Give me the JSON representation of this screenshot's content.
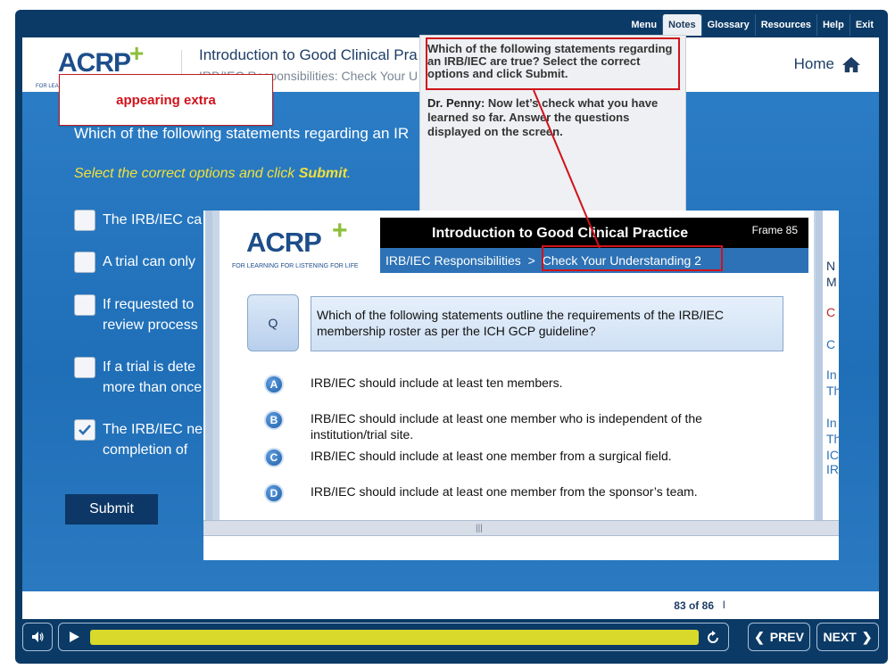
{
  "top_menu": [
    "Menu",
    "Notes",
    "Glossary",
    "Resources",
    "Help",
    "Exit"
  ],
  "header": {
    "logo": "ACRP",
    "tagline": "FOR LEARNING",
    "course_title": "Introduction to Good Clinical Pra",
    "course_subtitle": "IRB/IEC Responsibilities: Check Your U",
    "home_label": "Home"
  },
  "question": {
    "text": "Which of the following statements regarding an IR",
    "instruction_prefix": "Select the correct options and click ",
    "instruction_bold": "Submit",
    "instruction_suffix": ".",
    "options": [
      {
        "text": "The IRB/IEC ca",
        "checked": false
      },
      {
        "text": "A trial can only",
        "checked": false
      },
      {
        "text": "If requested to review process",
        "checked": false
      },
      {
        "text": "If a trial is dete more than once",
        "checked": false
      },
      {
        "text": "The IRB/IEC ne completion of",
        "checked": true
      }
    ],
    "submit_label": "Submit"
  },
  "footer": {
    "page_count": "83 of 86",
    "separator": "I"
  },
  "controls": {
    "prev_label": "PREV",
    "next_label": "NEXT",
    "progress_fraction": 1.0
  },
  "notes": {
    "question": "Which of the following statements regarding an IRB/IEC are true? Select the correct options and click Submit.",
    "speaker": "Dr. Penny:",
    "speech": "Now let’s check what you have learned so far. Answer the questions displayed on the screen."
  },
  "annotation": {
    "label": "appearing extra"
  },
  "overlay": {
    "logo": "ACRP",
    "tagline": "FOR LEARNING  FOR LISTENING  FOR LIFE",
    "title": "Introduction to Good Clinical Practice",
    "frame": "Frame 85",
    "breadcrumb_section": "IRB/IEC Responsibilities",
    "breadcrumb_sep": ">",
    "breadcrumb_page": "Check Your Understanding 2",
    "q_label": "Q",
    "question": "Which of the following statements outline the requirements of the IRB/IEC membership roster as per the ICH GCP guideline?",
    "options": [
      {
        "letter": "A",
        "text": "IRB/IEC should include at least ten members."
      },
      {
        "letter": "B",
        "text": "IRB/IEC should include at least one member who is independent of the institution/trial site."
      },
      {
        "letter": "C",
        "text": "IRB/IEC should include at least one member from a surgical field."
      },
      {
        "letter": "D",
        "text": "IRB/IEC should include at least one member from the sponsor’s team."
      }
    ],
    "scroll_grip": "|||",
    "side_fragments": [
      "N",
      "M",
      "C",
      "C",
      "In",
      "Th",
      "In",
      "Th",
      "IC",
      "IR"
    ]
  },
  "colors": {
    "accent_red": "#d0121b",
    "progress_yellow": "#d8d92a",
    "player_navy": "#0b3a66",
    "instruction_yellow": "#f2e03b"
  }
}
